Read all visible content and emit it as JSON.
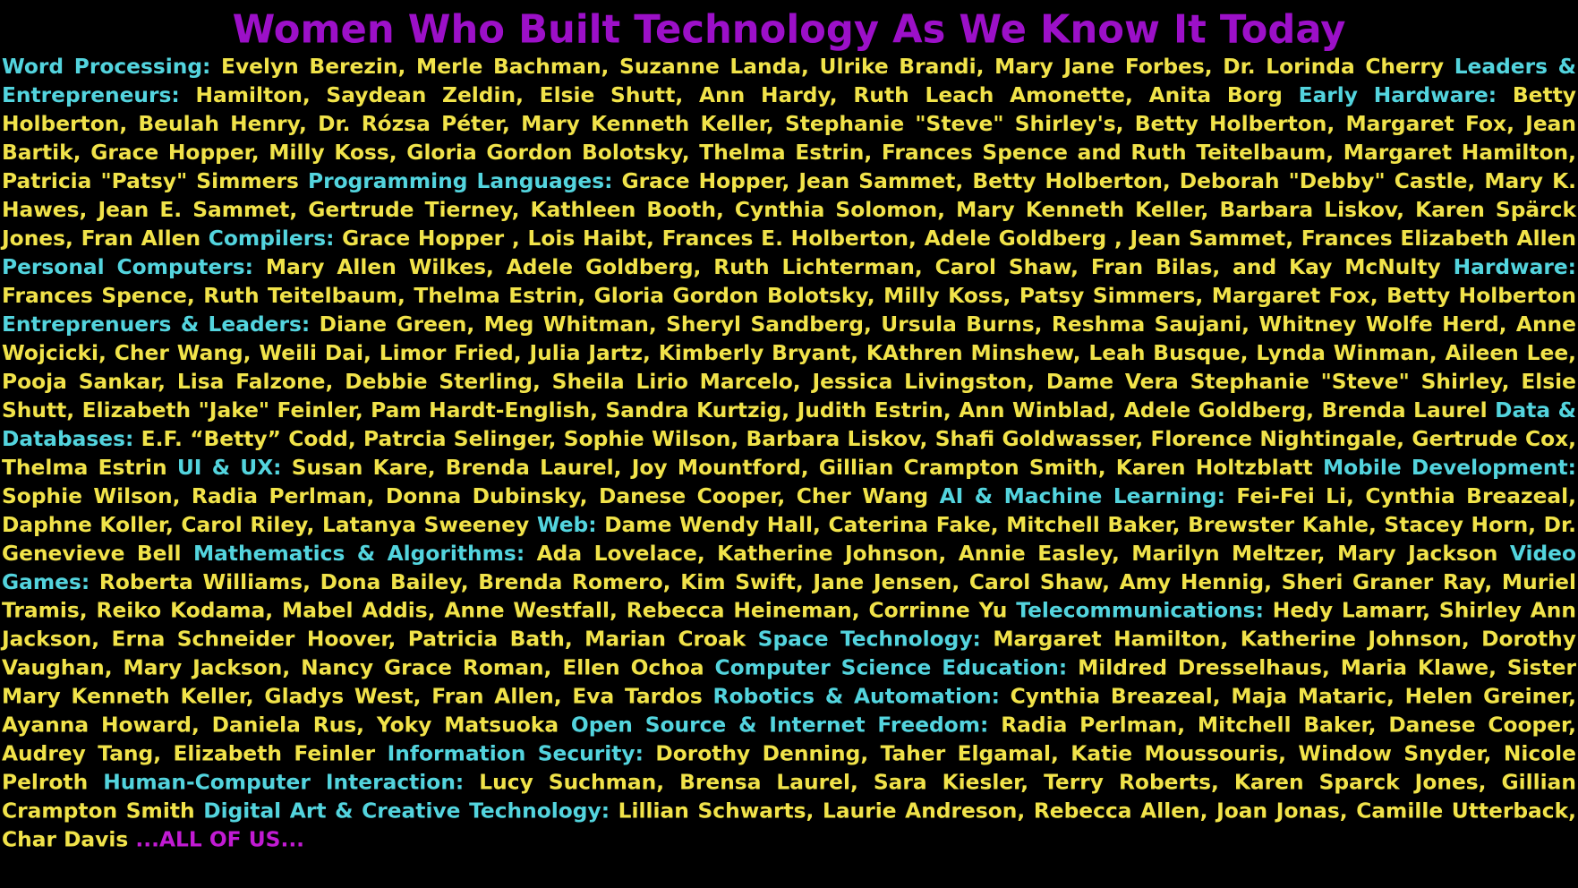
{
  "title": "Women Who Built Technology As We Know It Today",
  "colors": {
    "background": "#000000",
    "title": "#9c10c8",
    "category": "#53d4de",
    "names": "#f1e34a",
    "closing": "#c21bd4"
  },
  "sections": [
    {
      "category": "Word Processing:",
      "names": "Evelyn Berezin, Merle Bachman, Suzanne Landa, Ulrike Brandi, Mary Jane Forbes, Dr. Lorinda Cherry"
    },
    {
      "category": "Leaders & Entrepreneurs:",
      "names": "Hamilton, Saydean Zeldin, Elsie Shutt, Ann Hardy, Ruth Leach Amonette, Anita Borg"
    },
    {
      "category": "Early Hardware:",
      "names": "Betty Holberton, Beulah Henry, Dr. Rózsa Péter, Mary Kenneth Keller, Stephanie \"Steve\" Shirley's, Betty Holberton, Margaret Fox, Jean Bartik, Grace Hopper, Milly Koss, Gloria Gordon Bolotsky, Thelma Estrin, Frances Spence and Ruth Teitelbaum, Margaret Hamilton, Patricia \"Patsy\" Simmers"
    },
    {
      "category": "Programming Languages:",
      "names": "Grace Hopper, Jean Sammet, Betty Holberton, Deborah \"Debby\" Castle,  Mary K. Hawes, Jean E. Sammet, Gertrude Tierney, Kathleen Booth, Cynthia Solomon, Mary Kenneth Keller, Barbara Liskov, Karen Spärck Jones, Fran Allen"
    },
    {
      "category": "Compilers:",
      "names": "Grace Hopper , Lois Haibt, Frances E. Holberton, Adele Goldberg , Jean Sammet, Frances Elizabeth Allen"
    },
    {
      "category": "Personal Computers:",
      "names": "Mary Allen Wilkes, Adele Goldberg, Ruth Lichterman, Carol Shaw, Fran Bilas, and Kay McNulty"
    },
    {
      "category": "Hardware:",
      "names": "Frances Spence, Ruth Teitelbaum, Thelma Estrin, Gloria Gordon Bolotsky, Milly Koss, Patsy Simmers, Margaret Fox, Betty Holberton "
    },
    {
      "category": "Entreprenuers & Leaders:",
      "names": "Diane Green, Meg Whitman, Sheryl Sandberg, Ursula Burns, Reshma Saujani, Whitney Wolfe Herd, Anne Wojcicki, Cher Wang, Weili Dai, Limor Fried, Julia Jartz, Kimberly Bryant, KAthren Minshew, Leah Busque, Lynda Winman, Aileen Lee, Pooja Sankar, Lisa Falzone, Debbie Sterling, Sheila Lirio Marcelo, Jessica Livingston, Dame Vera Stephanie \"Steve\" Shirley, Elsie Shutt, Elizabeth \"Jake\" Feinler, Pam Hardt-English, Sandra Kurtzig, Judith Estrin, Ann Winblad, Adele Goldberg, Brenda Laurel "
    },
    {
      "category": "Data & Databases:",
      "names": "E.F. “Betty” Codd, Patrcia Selinger, Sophie Wilson, Barbara Liskov, Shafi Goldwasser, Florence Nightingale, Gertrude Cox, Thelma Estrin"
    },
    {
      "category": "UI & UX:",
      "names": "Susan Kare, Brenda Laurel, Joy Mountford, Gillian Crampton Smith, Karen Holtzblatt"
    },
    {
      "category": "Mobile Development:",
      "names": "Sophie Wilson, Radia Perlman, Donna Dubinsky, Danese Cooper, Cher Wang"
    },
    {
      "category": "AI & Machine Learning:",
      "names": "Fei-Fei Li, Cynthia Breazeal, Daphne Koller, Carol Riley, Latanya Sweeney"
    },
    {
      "category": "Web:",
      "names": "Dame Wendy Hall, Caterina Fake, Mitchell Baker, Brewster Kahle, Stacey Horn, Dr. Genevieve Bell"
    },
    {
      "category": "Mathematics & Algorithms:",
      "names": "Ada Lovelace, Katherine Johnson, Annie Easley, Marilyn Meltzer, Mary Jackson"
    },
    {
      "category": "Video Games:",
      "names": "Roberta Williams, Dona Bailey, Brenda Romero, Kim Swift, Jane Jensen, Carol Shaw, Amy Hennig, Sheri Graner Ray, Muriel Tramis, Reiko Kodama, Mabel Addis, Anne Westfall, Rebecca Heineman, Corrinne Yu"
    },
    {
      "category": "Telecommunications:",
      "names": "Hedy Lamarr, Shirley Ann Jackson, Erna Schneider Hoover, Patricia Bath, Marian Croak"
    },
    {
      "category": "Space Technology:",
      "names": "Margaret Hamilton, Katherine Johnson, Dorothy Vaughan, Mary Jackson, Nancy Grace Roman, Ellen Ochoa"
    },
    {
      "category": "Computer Science Education:",
      "names": "Mildred Dresselhaus, Maria Klawe, Sister Mary Kenneth Keller, Gladys West, Fran Allen, Eva Tardos"
    },
    {
      "category": "Robotics & Automation:",
      "names": "Cynthia Breazeal, Maja Mataric, Helen Greiner, Ayanna Howard, Daniela Rus, Yoky Matsuoka"
    },
    {
      "category": "Open Source & Internet Freedom:",
      "names": "Radia Perlman, Mitchell Baker, Danese Cooper, Audrey Tang, Elizabeth Feinler"
    },
    {
      "category": "Information Security:",
      "names": "Dorothy Denning, Taher Elgamal, Katie Moussouris, Window Snyder, Nicole Pelroth"
    },
    {
      "category": "Human-Computer Interaction:",
      "names": "Lucy Suchman, Brensa Laurel, Sara Kiesler, Terry Roberts, Karen Sparck Jones, Gillian Crampton Smith"
    },
    {
      "category": "Digital Art & Creative Technology:",
      "names": "Lillian Schwarts, Laurie Andreson, Rebecca Allen, Joan Jonas, Camille Utterback, Char Davis"
    }
  ],
  "closing": "...ALL OF US..."
}
